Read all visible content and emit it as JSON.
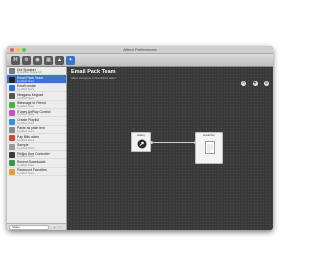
{
  "window": {
    "title": "Alfred Preferences"
  },
  "toolbar": {
    "buttons": [
      {
        "name": "workflows-tab",
        "glyph": "⌘"
      },
      {
        "name": "general-tab",
        "glyph": "⚙"
      },
      {
        "name": "features-tab",
        "glyph": "◉"
      },
      {
        "name": "appearance-tab",
        "glyph": "▦"
      },
      {
        "name": "remote-tab",
        "glyph": "▲"
      },
      {
        "name": "advanced-tab",
        "glyph": "✦"
      }
    ]
  },
  "sidebar": {
    "items": [
      {
        "name": "Dot Speaker",
        "sub": "by Andrew Pepperrell",
        "color": "#7a7a7a"
      },
      {
        "name": "Email Pack Team",
        "sub": "by Alfred Team",
        "color": "#222222"
      },
      {
        "name": "Email create",
        "sub": "by Alfred Team",
        "color": "#2a6fd6"
      },
      {
        "name": "Hiragana Keypad",
        "sub": "by Alfred Team",
        "color": "#555555"
      },
      {
        "name": "iMessage to Friend",
        "sub": "by Alfred Team",
        "color": "#4ab04a"
      },
      {
        "name": "iTunes AirPlay Control",
        "sub": "by Alfred Team",
        "color": "#c94fc9"
      },
      {
        "name": "Create Playlist",
        "sub": "by Alfred Team",
        "color": "#3b8de0"
      },
      {
        "name": "Paste as plain text",
        "sub": "by Alfred Team",
        "color": "#8a8a8a"
      },
      {
        "name": "Pay Bills video",
        "sub": "by Alfred Team",
        "color": "#d24a3b"
      },
      {
        "name": "Sample",
        "sub": "by Alfred Team",
        "color": "#9a9a9a"
      },
      {
        "name": "Philips Hue Controller",
        "sub": "by Alfred Team",
        "color": "#3a3a3a"
      },
      {
        "name": "Recent Downloads",
        "sub": "by Alfred Team",
        "color": "#3a9a4a"
      },
      {
        "name": "Password Favorites",
        "sub": "by Alfred Team",
        "color": "#e0a030"
      }
    ],
    "selected_index": 1,
    "search_value": "Share",
    "add_label": "+",
    "remove_label": "−"
  },
  "main": {
    "title": "Email Pack Team",
    "description": "Allow everyone in the Alfred team",
    "header_icons": [
      "⎘",
      "✚",
      "⚙"
    ]
  },
  "workflow": {
    "nodes": [
      {
        "label": "Hotkey",
        "icon": "hotkey-icon"
      },
      {
        "label": "Email File",
        "icon": "document-icon"
      }
    ]
  }
}
